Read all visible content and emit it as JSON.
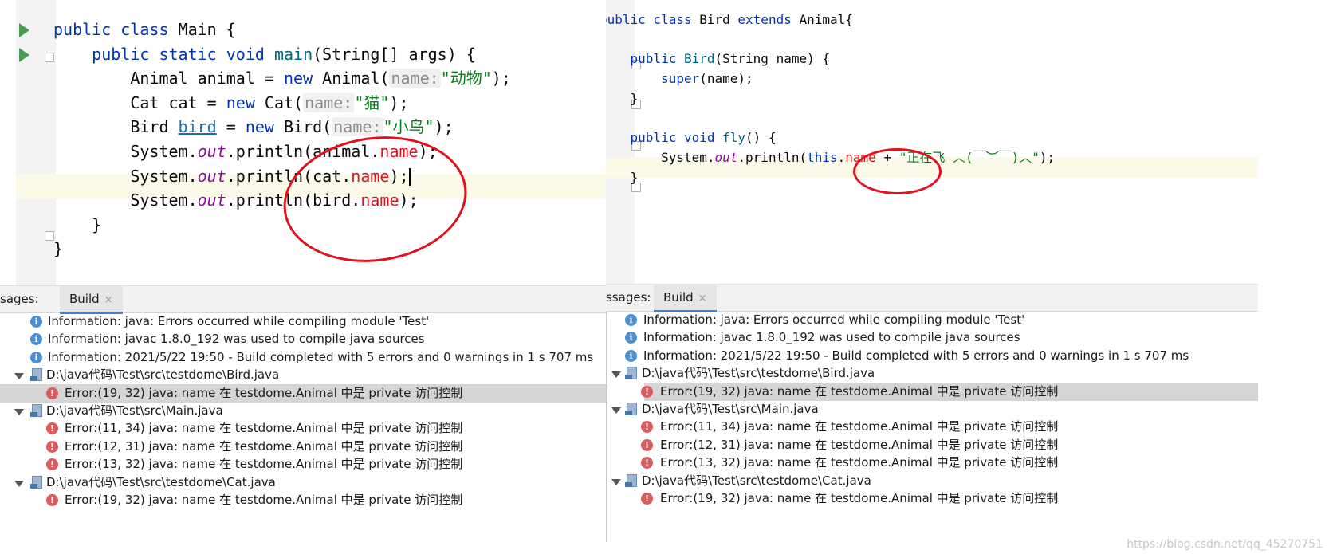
{
  "left_panel": {
    "code_lines": [
      {
        "tokens": [
          [
            "kw",
            "public class "
          ],
          [
            "",
            "Main {"
          ]
        ]
      },
      {
        "tokens": [
          [
            "",
            "    "
          ],
          [
            "kw",
            "public static void "
          ],
          [
            "fn",
            "main"
          ],
          [
            "",
            "(String[] args) {"
          ]
        ]
      },
      {
        "tokens": [
          [
            "",
            "        Animal animal = "
          ],
          [
            "kw",
            "new "
          ],
          [
            "",
            "Animal("
          ],
          [
            "hint",
            "name:"
          ],
          [
            "st",
            "\"动物\""
          ],
          [
            "",
            ");"
          ]
        ]
      },
      {
        "tokens": [
          [
            "",
            "        Cat cat = "
          ],
          [
            "kw",
            "new "
          ],
          [
            "",
            "Cat("
          ],
          [
            "hint",
            "name:"
          ],
          [
            "st",
            "\"猫\""
          ],
          [
            "",
            ");"
          ]
        ]
      },
      {
        "tokens": [
          [
            "",
            "        Bird "
          ],
          [
            "und",
            "bird"
          ],
          [
            "",
            " = "
          ],
          [
            "kw",
            "new "
          ],
          [
            "",
            "Bird("
          ],
          [
            "hint",
            "name:"
          ],
          [
            "st",
            "\"小鸟\""
          ],
          [
            "",
            ");"
          ]
        ]
      },
      {
        "tokens": [
          [
            "",
            "        System."
          ],
          [
            "stat",
            "out"
          ],
          [
            "",
            ".println(animal."
          ],
          [
            "fld",
            "name"
          ],
          [
            "",
            ");"
          ]
        ]
      },
      {
        "tokens": [
          [
            "",
            "        System."
          ],
          [
            "stat",
            "out"
          ],
          [
            "",
            ".println(cat."
          ],
          [
            "fld",
            "name"
          ],
          [
            "",
            ");"
          ],
          [
            "caret",
            ""
          ]
        ]
      },
      {
        "tokens": [
          [
            "",
            "        System."
          ],
          [
            "stat",
            "out"
          ],
          [
            "",
            ".println(bird."
          ],
          [
            "fld",
            "name"
          ],
          [
            "",
            ");"
          ]
        ]
      },
      {
        "tokens": [
          [
            "",
            "    }"
          ]
        ]
      },
      {
        "tokens": [
          [
            "",
            "}"
          ]
        ]
      }
    ],
    "tab_bar": {
      "messages_label": "sages:",
      "build_tab_label": "Build",
      "close_glyph": "×"
    },
    "messages": [
      {
        "kind": "info",
        "text": "Information: java: Errors occurred while compiling module 'Test'"
      },
      {
        "kind": "info",
        "text": "Information: javac 1.8.0_192 was used to compile java sources"
      },
      {
        "kind": "info",
        "text": "Information: 2021/5/22 19:50 - Build completed with 5 errors and 0 warnings in 1 s 707 ms"
      },
      {
        "kind": "file",
        "text": "D:\\java代码\\Test\\src\\testdome\\Bird.java"
      },
      {
        "kind": "error",
        "text": "Error:(19, 32)  java: name 在 testdome.Animal 中是 private 访问控制",
        "selected": true
      },
      {
        "kind": "file",
        "text": "D:\\java代码\\Test\\src\\Main.java"
      },
      {
        "kind": "error",
        "text": "Error:(11, 34)  java: name 在 testdome.Animal 中是 private 访问控制"
      },
      {
        "kind": "error",
        "text": "Error:(12, 31)  java: name 在 testdome.Animal 中是 private 访问控制"
      },
      {
        "kind": "error",
        "text": "Error:(13, 32)  java: name 在 testdome.Animal 中是 private 访问控制"
      },
      {
        "kind": "file",
        "text": "D:\\java代码\\Test\\src\\testdome\\Cat.java"
      },
      {
        "kind": "error",
        "text": "Error:(19, 32)  java: name 在 testdome.Animal 中是 private 访问控制"
      }
    ]
  },
  "right_panel": {
    "code_lines": [
      {
        "tokens": [
          [
            "kw",
            "public class "
          ],
          [
            "",
            "Bird "
          ],
          [
            "kw",
            "extends "
          ],
          [
            "",
            "Animal{"
          ]
        ]
      },
      {
        "tokens": []
      },
      {
        "tokens": [
          [
            "",
            "    "
          ],
          [
            "kw",
            "public "
          ],
          [
            "fn",
            "Bird"
          ],
          [
            "",
            "(String name) {"
          ]
        ]
      },
      {
        "tokens": [
          [
            "",
            "        "
          ],
          [
            "kw",
            "super"
          ],
          [
            "",
            "(name);"
          ]
        ]
      },
      {
        "tokens": [
          [
            "",
            "    }"
          ]
        ]
      },
      {
        "tokens": []
      },
      {
        "tokens": [
          [
            "",
            "    "
          ],
          [
            "kw",
            "public void "
          ],
          [
            "fn",
            "fly"
          ],
          [
            "",
            "() {"
          ]
        ]
      },
      {
        "tokens": [
          [
            "",
            "        System."
          ],
          [
            "stat",
            "out"
          ],
          [
            "",
            ".println("
          ],
          [
            "kw",
            "this"
          ],
          [
            "",
            "."
          ],
          [
            "fld",
            "name"
          ],
          [
            "",
            " + "
          ],
          [
            "st",
            "\"正在飞 ︿(￣︶￣)︿\""
          ],
          [
            "",
            ");"
          ]
        ]
      },
      {
        "tokens": [
          [
            "",
            "    }"
          ]
        ]
      },
      {
        "tokens": [
          [
            "",
            "}"
          ]
        ]
      }
    ],
    "tab_bar": {
      "messages_label": "ssages:",
      "build_tab_label": "Build",
      "close_glyph": "×"
    },
    "messages": [
      {
        "kind": "info",
        "text": "Information: java: Errors occurred while compiling module 'Test'"
      },
      {
        "kind": "info",
        "text": "Information: javac 1.8.0_192 was used to compile java sources"
      },
      {
        "kind": "info",
        "text": "Information: 2021/5/22 19:50 - Build completed with 5 errors and 0 warnings in 1 s 707 ms"
      },
      {
        "kind": "file",
        "text": "D:\\java代码\\Test\\src\\testdome\\Bird.java"
      },
      {
        "kind": "error",
        "text": "Error:(19, 32)  java: name 在 testdome.Animal 中是 private 访问控制",
        "selected": true
      },
      {
        "kind": "file",
        "text": "D:\\java代码\\Test\\src\\Main.java"
      },
      {
        "kind": "error",
        "text": "Error:(11, 34)  java: name 在 testdome.Animal 中是 private 访问控制"
      },
      {
        "kind": "error",
        "text": "Error:(12, 31)  java: name 在 testdome.Animal 中是 private 访问控制"
      },
      {
        "kind": "error",
        "text": "Error:(13, 32)  java: name 在 testdome.Animal 中是 private 访问控制"
      },
      {
        "kind": "file",
        "text": "D:\\java代码\\Test\\src\\testdome\\Cat.java"
      },
      {
        "kind": "error",
        "text": "Error:(19, 32)  java: name 在 testdome.Animal 中是 private 访问控制"
      }
    ]
  },
  "icons": {
    "info": "i",
    "error": "!"
  },
  "watermark": "https://blog.csdn.net/qq_45270751",
  "colors": {
    "keyword": "#0033b3",
    "string": "#067d17",
    "field": "#e0121f",
    "static": "#871094",
    "annotation_circle": "#e0121f"
  }
}
